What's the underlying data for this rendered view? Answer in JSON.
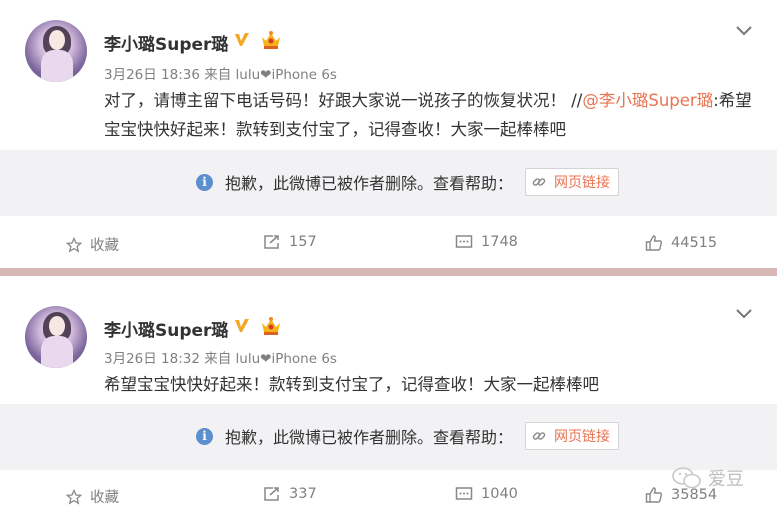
{
  "posts": [
    {
      "username": "李小璐Super璐",
      "meta": "3月26日 18:36 来自 lulu❤iPhone 6s",
      "content_main": "对了，请博主留下电话号码！好跟大家说一说孩子的恢复状况！",
      "content_sep": " //",
      "mention": "@李小璐Super璐",
      "content_rest": ":希望宝宝快快好起来！款转到支付宝了，记得查收！大家一起棒棒吧",
      "deleted_text": "抱歉，此微博已被作者删除。查看帮助：",
      "link_label": "网页链接",
      "favorite_label": "收藏",
      "repost_count": "157",
      "comment_count": "1748",
      "like_count": "44515"
    },
    {
      "username": "李小璐Super璐",
      "meta": "3月26日 18:32 来自 lulu❤iPhone 6s",
      "content": "希望宝宝快快好起来！款转到支付宝了，记得查收！大家一起棒棒吧",
      "deleted_text": "抱歉，此微博已被作者删除。查看帮助：",
      "link_label": "网页链接",
      "favorite_label": "收藏",
      "repost_count": "337",
      "comment_count": "1040",
      "like_count": "35854"
    }
  ],
  "watermark": {
    "label": "爱豆"
  },
  "colors": {
    "accent": "#eb7350",
    "info": "#5d8fcf",
    "verified": "#f5a623",
    "divider": "#d9b8b8"
  },
  "icons": [
    "chevron-down-icon",
    "verified-v-icon",
    "vip-crown-icon",
    "info-icon",
    "link-icon",
    "star-icon",
    "repost-icon",
    "comment-icon",
    "like-icon",
    "wechat-icon"
  ]
}
